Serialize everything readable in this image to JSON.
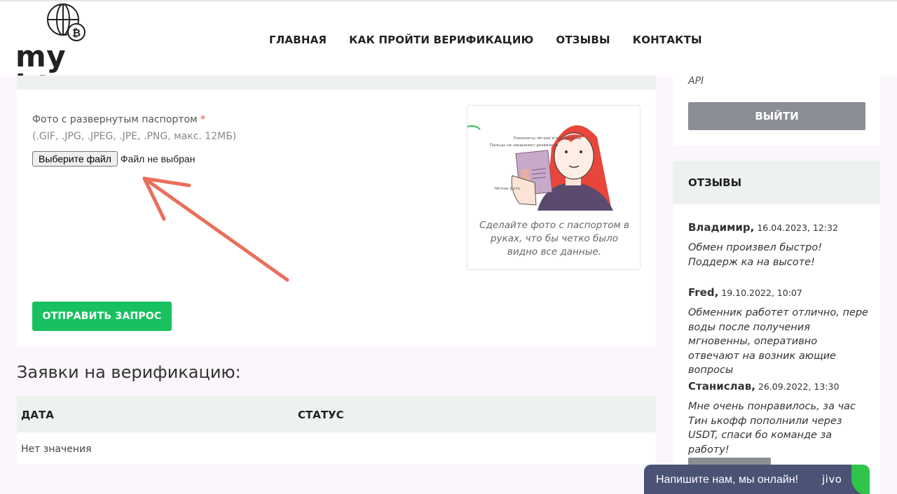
{
  "header": {
    "logo_text": "my btc",
    "nav": [
      "ГЛАВНАЯ",
      "КАК ПРОЙТИ ВЕРИФИКАЦИЮ",
      "ОТЗЫВЫ",
      "КОНТАКТЫ"
    ]
  },
  "form": {
    "field_label": "Фото с развернутым паспортом",
    "required_mark": "*",
    "field_hint": "(.GIF, .JPG, .JPEG, .JPE, .PNG, макс. 12МБ)",
    "file_button": "Выберите файл",
    "file_status": "Файл не выбран",
    "example": {
      "caption": "Сделайте фото с паспортом в руках, что бы четко было видно все данные.",
      "label_top": "Реквизиты чёткие и не обрезаны",
      "label_left": "Пальцы не закрывают реквизиты",
      "label_bottom": "Чёткое фото"
    },
    "submit_button": "ОТПРАВИТЬ ЗАПРОС"
  },
  "requests": {
    "title": "Заявки на верификацию:",
    "columns": [
      "ДАТА",
      "СТАТУС"
    ],
    "empty_text": "Нет значения"
  },
  "sidebar": {
    "api_text": "API",
    "logout_button": "ВЫЙТИ",
    "reviews_title": "ОТЗЫВЫ",
    "reviews": [
      {
        "author": "Владимир,",
        "date": "16.04.2023, 12:32",
        "text": "Обмен произвел быстро! Поддерж ка на высоте!"
      },
      {
        "author": "Fred,",
        "date": "19.10.2022, 10:07",
        "text": "Обменник работет отлично, пере воды после получения мгновенны, оперативно отвечают на возник ающие вопросы"
      },
      {
        "author": "Станислав,",
        "date": "26.09.2022, 13:30",
        "text": "Мне очень понравилось, за час Тин ькофф пополнили через USDT, спаси бо команде за работу!"
      }
    ]
  },
  "chat": {
    "text": "Напишите нам, мы онлайн!",
    "logo": "jivo"
  },
  "colors": {
    "accent_green": "#18c15f",
    "gray_button": "#8b8e95",
    "chat_bg": "#4a5275",
    "arrow_red": "#e8604a"
  }
}
